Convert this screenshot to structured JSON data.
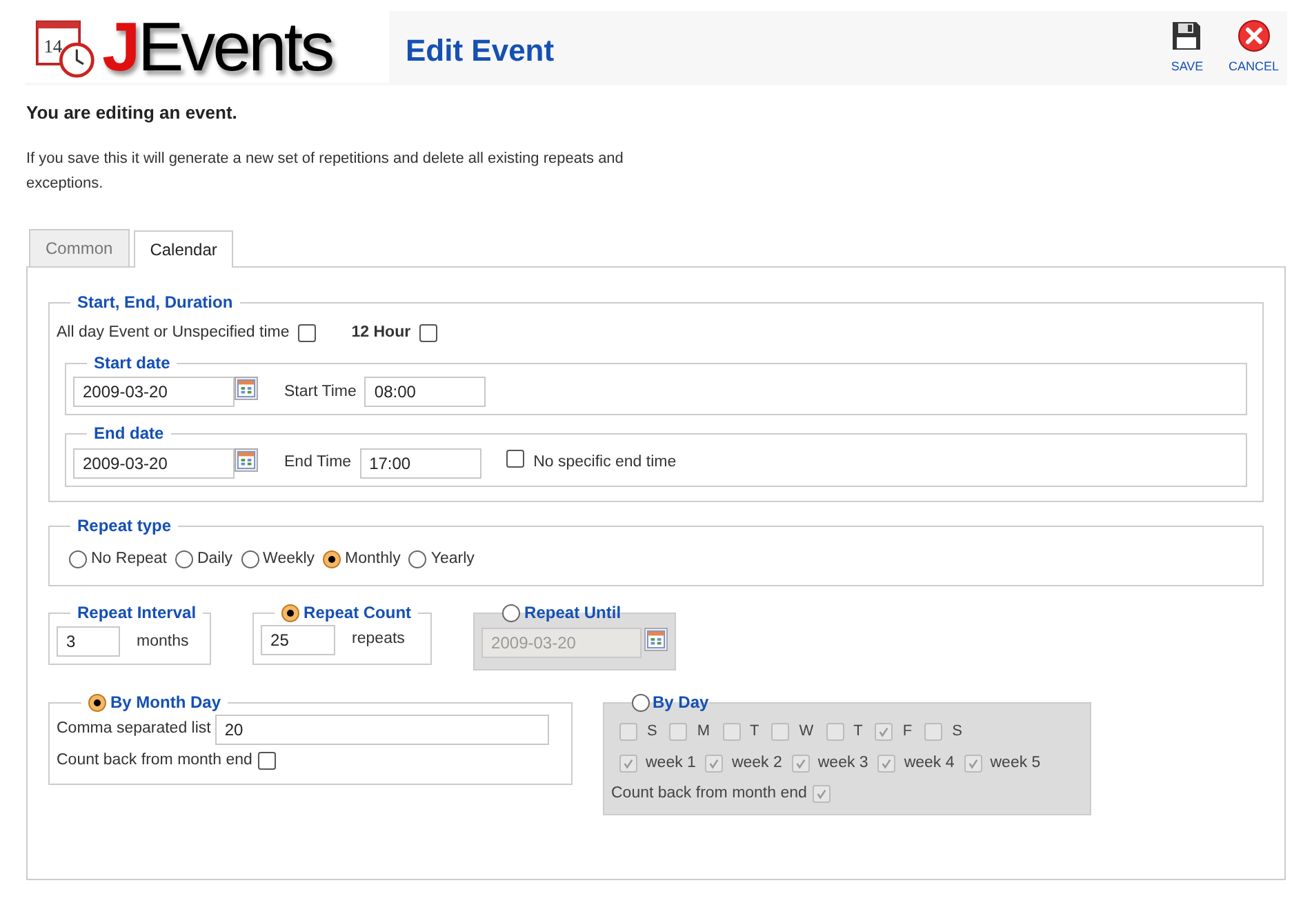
{
  "header": {
    "logo": {
      "day": "14",
      "initial": "J",
      "rest": "Events"
    },
    "title": "Edit Event",
    "toolbar": [
      {
        "kind": "save",
        "label": "SAVE"
      },
      {
        "kind": "cancel",
        "label": "CANCEL"
      }
    ]
  },
  "heading": "You are editing an event.",
  "notice": "If you save this it will generate a new set of repetitions and delete all existing repeats and exceptions.",
  "tabs": [
    {
      "label": "Common",
      "selected": false
    },
    {
      "label": "Calendar",
      "selected": true
    }
  ],
  "duration": {
    "legend": "Start, End, Duration",
    "all_day": {
      "label": "All day Event or Unspecified time",
      "checked": false
    },
    "twelve_hour": {
      "label": "12 Hour",
      "checked": false
    },
    "start": {
      "legend": "Start date",
      "date": "2009-03-20",
      "time_label": "Start Time",
      "time": "08:00"
    },
    "end": {
      "legend": "End date",
      "date": "2009-03-20",
      "time_label": "End Time",
      "time": "17:00",
      "no_end": {
        "label": "No specific end time",
        "checked": false
      }
    }
  },
  "repeat_type": {
    "legend": "Repeat type",
    "options": [
      {
        "label": "No Repeat",
        "selected": false
      },
      {
        "label": "Daily",
        "selected": false
      },
      {
        "label": "Weekly",
        "selected": false
      },
      {
        "label": "Monthly",
        "selected": true
      },
      {
        "label": "Yearly",
        "selected": false
      }
    ]
  },
  "repeat_interval": {
    "legend": "Repeat Interval",
    "value": "3",
    "unit": "months"
  },
  "repeat_count": {
    "legend": "Repeat Count",
    "selected": true,
    "value": "25",
    "unit": "repeats"
  },
  "repeat_until": {
    "legend": "Repeat Until",
    "selected": false,
    "disabled": true,
    "date": "2009-03-20"
  },
  "by_month_day": {
    "legend": "By Month Day",
    "selected": true,
    "list_label": "Comma separated list",
    "list": "20",
    "count_back": {
      "label": "Count back from month end",
      "checked": false
    }
  },
  "by_day": {
    "legend": "By Day",
    "selected": false,
    "disabled": true,
    "days": [
      {
        "label": "S",
        "checked": false
      },
      {
        "label": "M",
        "checked": false
      },
      {
        "label": "T",
        "checked": false
      },
      {
        "label": "W",
        "checked": false
      },
      {
        "label": "T",
        "checked": false
      },
      {
        "label": "F",
        "checked": true
      },
      {
        "label": "S",
        "checked": false
      }
    ],
    "weeks": [
      {
        "label": "week 1",
        "checked": true
      },
      {
        "label": "week 2",
        "checked": true
      },
      {
        "label": "week 3",
        "checked": true
      },
      {
        "label": "week 4",
        "checked": true
      },
      {
        "label": "week 5",
        "checked": true
      }
    ],
    "count_back": {
      "label": "Count back from month end",
      "checked": true
    }
  }
}
